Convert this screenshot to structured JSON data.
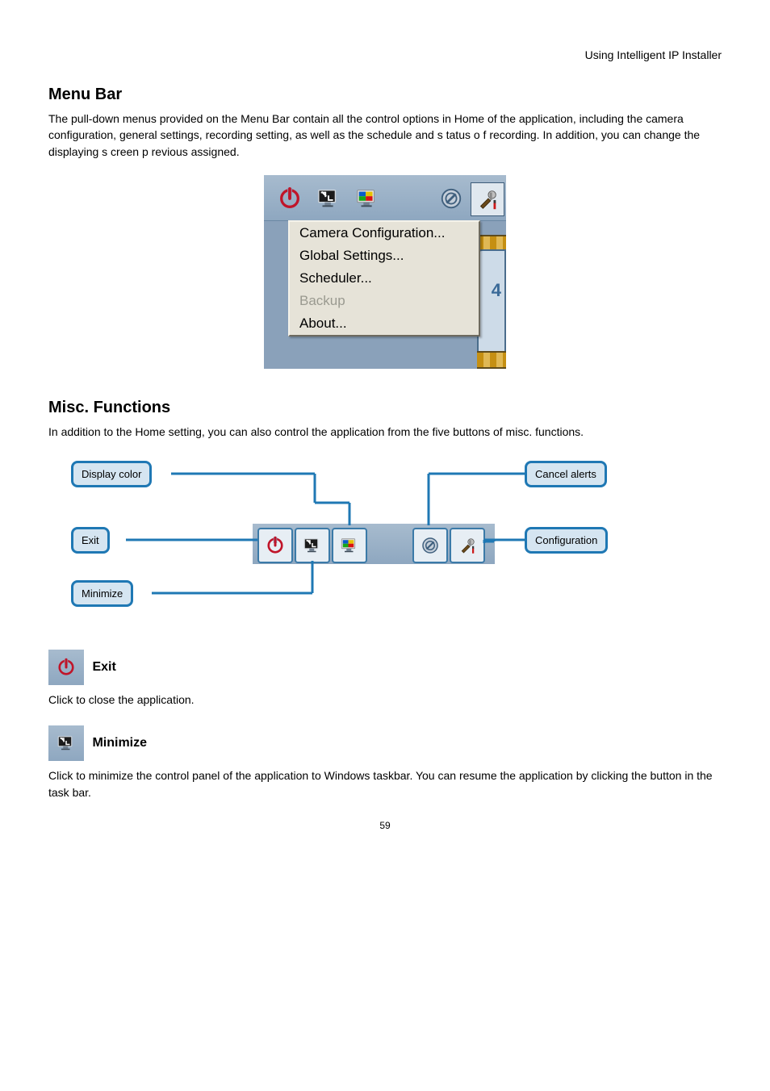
{
  "header_right": "Using Intelligent IP Installer",
  "section_title": "Menu Bar",
  "intro_para": "The pull-down menus provided on the Menu Bar contain all the control options in Home of the application, including the camera configuration, general settings, recording setting, as well as the schedule and s tatus o f recording. In addition, you can change the displaying s creen p revious assigned.",
  "screenshot": {
    "menu_items": [
      {
        "label": "Camera Configuration...",
        "disabled": false
      },
      {
        "label": "Global Settings...",
        "disabled": false
      },
      {
        "label": "Scheduler...",
        "disabled": false
      },
      {
        "label": "Backup",
        "disabled": true
      },
      {
        "label": "About...",
        "disabled": false
      }
    ],
    "four_glyph": "4"
  },
  "callouts": {
    "color": "Display color",
    "exit": "Exit",
    "minimize": "Minimize",
    "cancel_alerts": "Cancel alerts",
    "configuration": "Configuration"
  },
  "subhead2": "Misc. Functions",
  "misc_lead": "In addition to the Home setting, you can also control the application from the five buttons of misc. functions.",
  "exit_head": "Exit",
  "exit_body": "Click to close the application.",
  "minimize_head": "Minimize",
  "minimize_body": "Click to minimize the control panel of the application to Windows taskbar. You can resume the application by clicking the button in the task bar.",
  "page_number": "59"
}
